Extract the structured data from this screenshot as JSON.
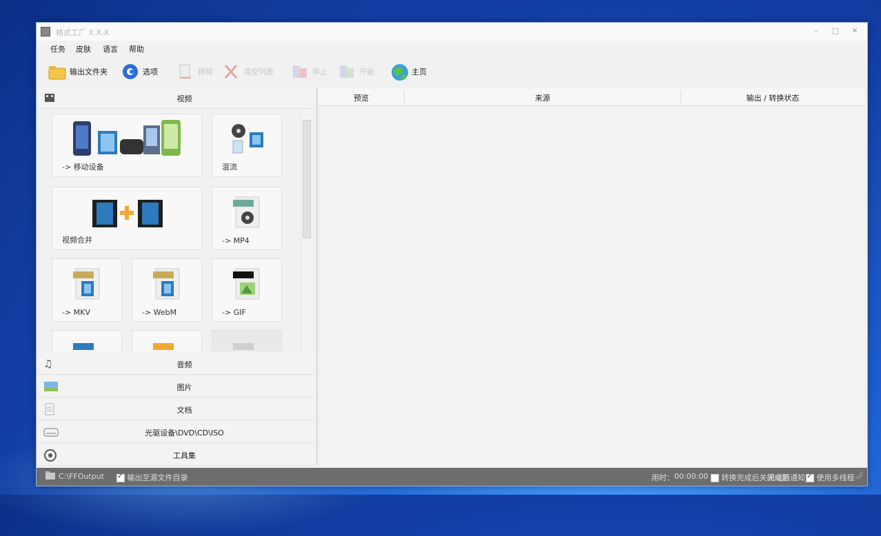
{
  "window": {
    "title": "格式工厂 X.X.X"
  },
  "menu": [
    "任务",
    "皮肤",
    "语言",
    "帮助"
  ],
  "toolbar": {
    "output_folder": "输出文件夹",
    "options": "选项",
    "remove": "移除",
    "clear_list": "清空列表",
    "stop": "停止",
    "start": "开始",
    "home": "主页"
  },
  "categories": {
    "video": "视频",
    "audio": "音频",
    "image": "图片",
    "document": "文档",
    "disc": "光驱设备\\DVD\\CD\\ISO",
    "tools": "工具集"
  },
  "tiles": {
    "mobile": "-> 移动设备",
    "mix": "混流",
    "join": "视频合并",
    "mp4": "-> MP4",
    "mkv": "-> MKV",
    "webm": "-> WebM",
    "gif": "-> GIF"
  },
  "table": {
    "col_preview": "预览",
    "col_source": "来源",
    "col_output": "输出 / 转换状态"
  },
  "status": {
    "output_path": "C:\\FFOutput",
    "output_to_source": "输出至源文件目录",
    "elapsed_label": "用时：",
    "elapsed": "00:00:00",
    "shutdown": "转换完成后关闭电脑",
    "notify": "完成后通知",
    "multithread": "使用多线程"
  },
  "colors": {
    "accent": "#1e6ad6",
    "status_bg": "#6d6d6d"
  }
}
